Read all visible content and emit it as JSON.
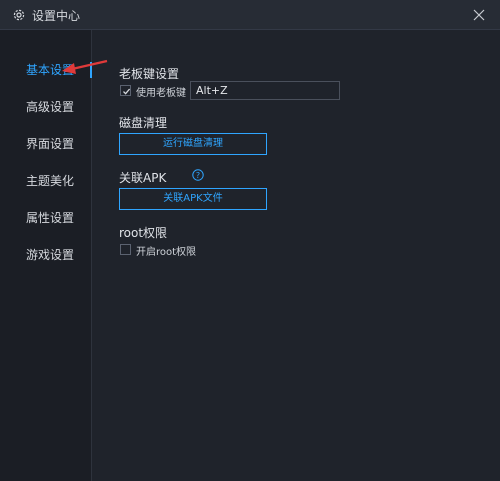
{
  "window": {
    "title": "设置中心"
  },
  "sidebar": {
    "items": [
      {
        "label": "基本设置",
        "active": true
      },
      {
        "label": "高级设置",
        "active": false
      },
      {
        "label": "界面设置",
        "active": false
      },
      {
        "label": "主题美化",
        "active": false
      },
      {
        "label": "属性设置",
        "active": false
      },
      {
        "label": "游戏设置",
        "active": false
      }
    ]
  },
  "boss_key": {
    "title": "老板键设置",
    "enable_label": "使用老板键",
    "enabled": true,
    "hotkey_value": "Alt+Z"
  },
  "disk_clean": {
    "title": "磁盘清理",
    "button_label": "运行磁盘清理"
  },
  "apk": {
    "title": "关联APK",
    "button_label": "关联APK文件"
  },
  "root": {
    "title": "root权限",
    "enable_label": "开启root权限",
    "enabled": false
  },
  "colors": {
    "accent": "#2fa5ff",
    "background": "#1f232b",
    "sidebar_bg": "#1b1e25",
    "titlebar_bg": "#272c35",
    "annotation_arrow": "#e03a3a"
  },
  "icons": {
    "title": "gear-icon",
    "close": "close-icon",
    "check": "check-icon",
    "help": "help-icon",
    "annotation": "red-arrow-annotation"
  }
}
